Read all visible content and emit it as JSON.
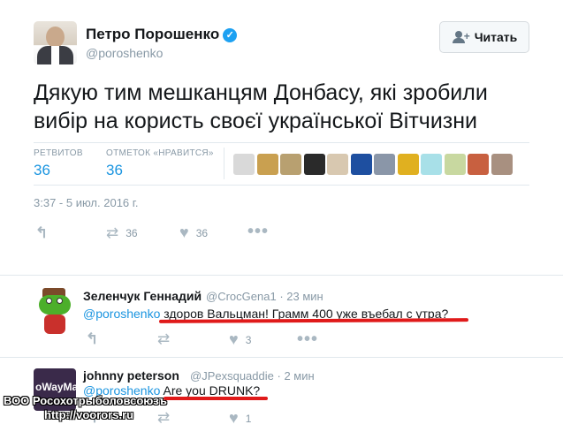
{
  "tweet": {
    "author_name": "Петро Порошенко",
    "author_handle": "@poroshenko",
    "follow_label": "Читать",
    "text": "Дякую тим мешканцям Донбасу, які зробили вибір на користь своєї української Вітчизни",
    "retweets_label": "РЕТВИТОВ",
    "retweets_count": "36",
    "likes_label": "ОТМЕТОК «НРАВИТСЯ»",
    "likes_count": "36",
    "timestamp": "3:37 - 5 июл. 2016 г.",
    "actions": {
      "retweet_count": "36",
      "like_count": "36"
    }
  },
  "likers": [
    {
      "color": "#d9d9d9"
    },
    {
      "color": "#c9a050"
    },
    {
      "color": "#b8a070"
    },
    {
      "color": "#2a2a2a"
    },
    {
      "color": "#d8c8b0"
    },
    {
      "color": "#1e4fa0"
    },
    {
      "color": "#8a96a8"
    },
    {
      "color": "#e0b020"
    },
    {
      "color": "#a8e0e8"
    },
    {
      "color": "#c8d8a0"
    },
    {
      "color": "#c86040"
    },
    {
      "color": "#a89080"
    }
  ],
  "replies": [
    {
      "name": "Зеленчук Геннадий",
      "handle": "@CrocGena1",
      "time": "· 23 мин",
      "mention": "@poroshenko",
      "text": " здоров Вальцман! Грамм 400 уже въебал с утра?",
      "like_count": "3"
    },
    {
      "name": "johnny peterson",
      "handle": "@JPexsquaddie",
      "time": "· 2 мин",
      "mention": "@poroshenko",
      "text": " Are you DRUNK?",
      "like_count": "1",
      "avatar_text": "oWayMa"
    }
  ],
  "watermark": {
    "line1": "ВОО Росохотрыболовсоюзъ",
    "line2": "http://voorors.ru"
  }
}
